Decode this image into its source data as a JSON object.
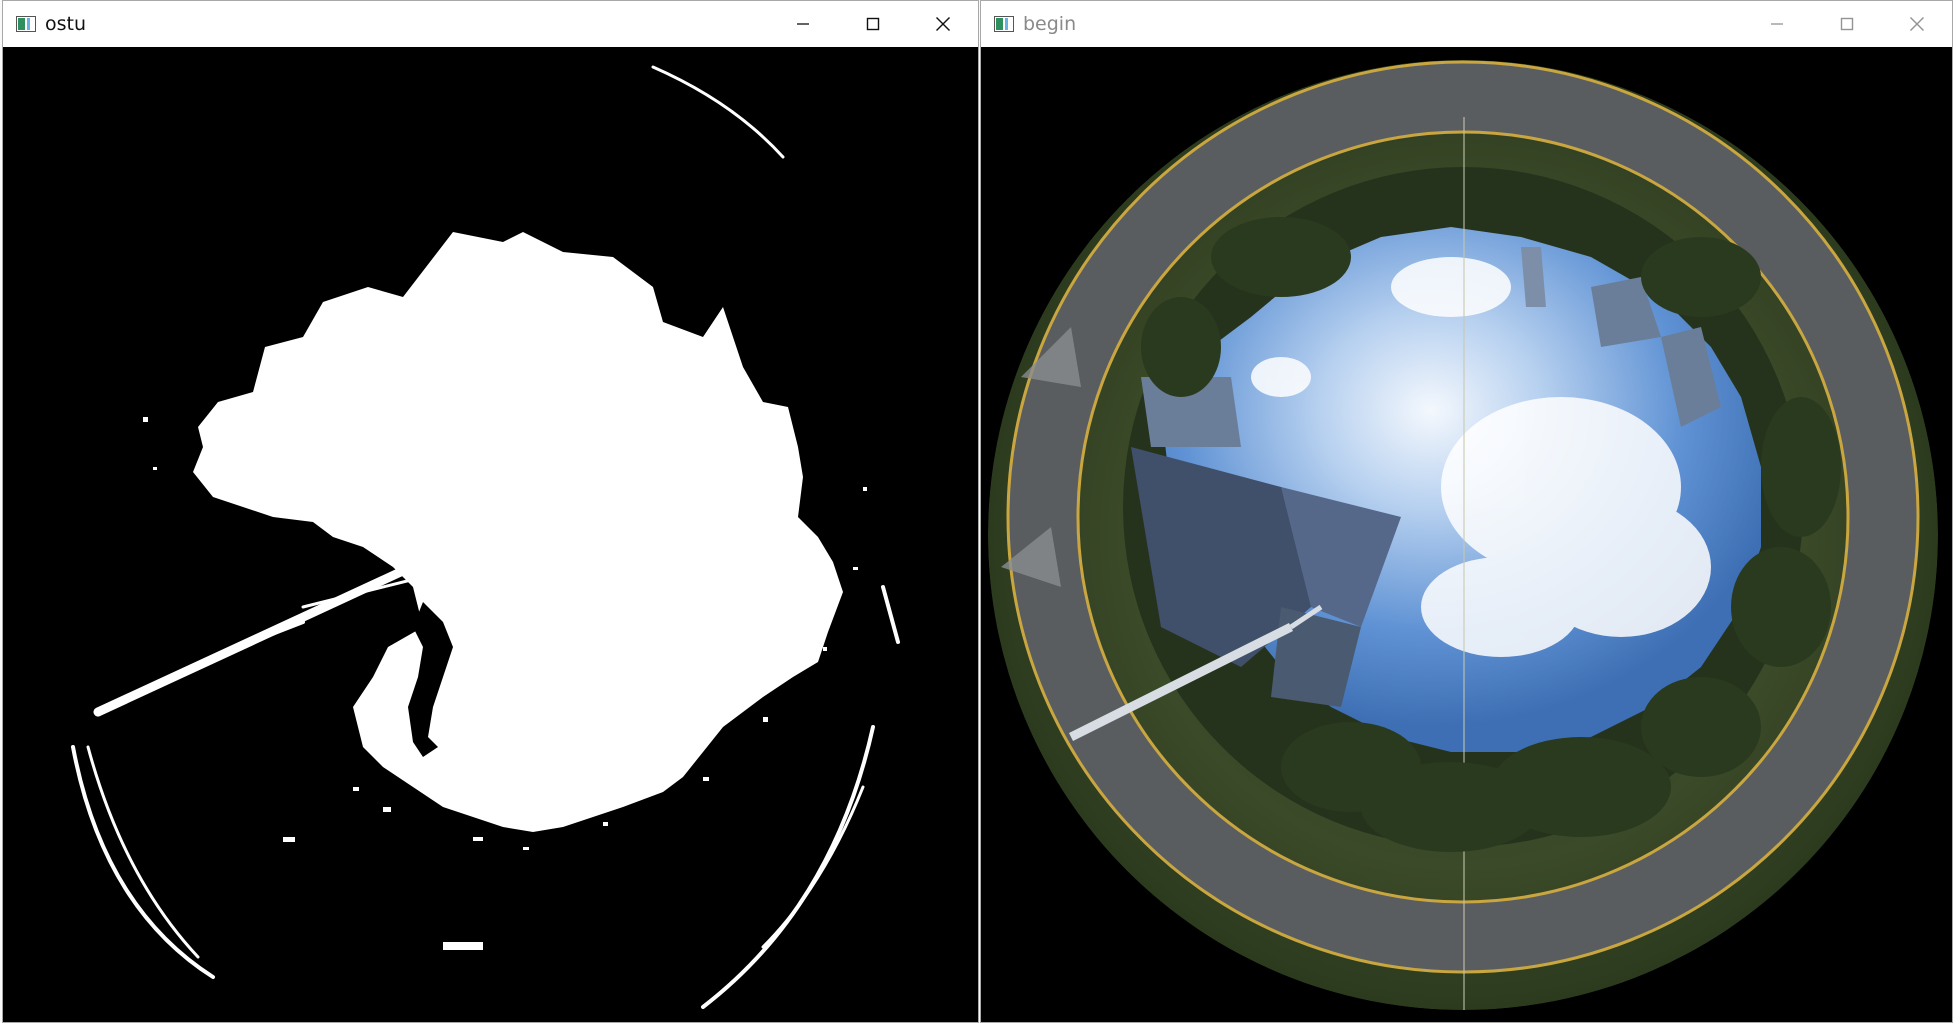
{
  "windows": {
    "ostu": {
      "title": "ostu",
      "content_icon": "binary-threshold-image",
      "active": true
    },
    "begin": {
      "title": "begin",
      "content_icon": "fisheye-sky-photo",
      "active": false
    }
  },
  "controls": {
    "minimize_icon": "minimize-icon",
    "maximize_icon": "maximize-icon",
    "close_icon": "close-icon"
  },
  "colors": {
    "titlebar": "#ffffff",
    "canvas": "#000000",
    "threshold_fg": "#ffffff",
    "sky": "#6f9ed8",
    "foliage": "#3a4a2a"
  }
}
